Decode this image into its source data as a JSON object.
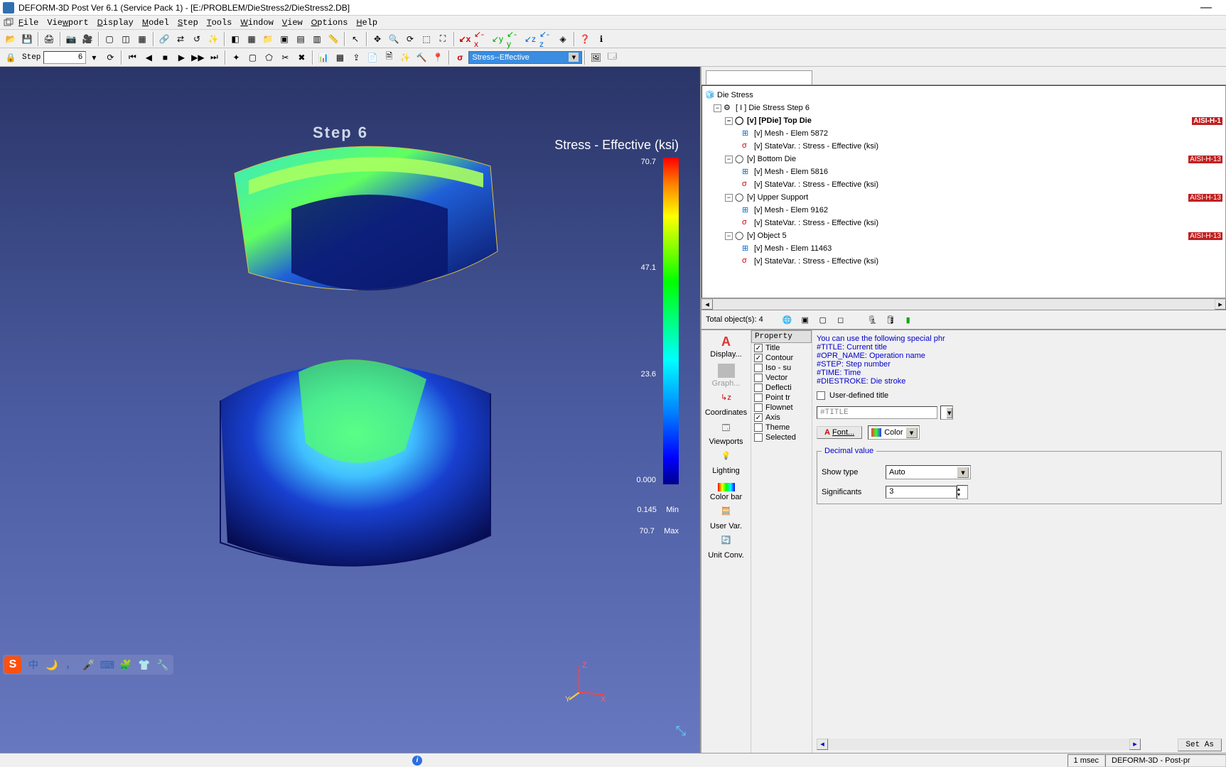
{
  "window": {
    "title": "DEFORM-3D Post Ver 6.1 (Service Pack 1)   - [E:/PROBLEM/DieStress2/DieStress2.DB]"
  },
  "menu": {
    "items": [
      "File",
      "Viewport",
      "Display",
      "Model",
      "Step",
      "Tools",
      "Window",
      "View",
      "Options",
      "Help"
    ]
  },
  "toolbar2": {
    "step_label": "Step",
    "step_value": "6",
    "variable": "Stress--Effective"
  },
  "viewport": {
    "step_title": "Step    6",
    "variable_title": "Stress - Effective (ksi)",
    "colorbar": {
      "max": "70.7",
      "t2": "47.1",
      "t3": "23.6",
      "min": "0.000"
    },
    "min_value": "0.145",
    "min_label": "Min",
    "max_value": "70.7",
    "max_label": "Max",
    "axes": {
      "x": "X",
      "y": "Y",
      "z": "Z"
    }
  },
  "tree": {
    "root": "Die Stress",
    "operation": "[ I ]  Die Stress  Step 6",
    "objects": [
      {
        "name": "[v] [PDie] Top Die",
        "material": "AISI-H-1",
        "mesh": "[v] Mesh - Elem 5872",
        "sv": "[v] StateVar. :  Stress - Effective (ksi)",
        "selected": true
      },
      {
        "name": "[v] Bottom Die",
        "material": "AISI-H-13",
        "mesh": "[v] Mesh - Elem 5816",
        "sv": "[v] StateVar. :  Stress - Effective (ksi)"
      },
      {
        "name": "[v] Upper Support",
        "material": "AISI-H-13",
        "mesh": "[v] Mesh - Elem 9162",
        "sv": "[v] StateVar. :  Stress - Effective (ksi)"
      },
      {
        "name": "[v] Object 5",
        "material": "AISI-H-13",
        "mesh": "[v] Mesh - Elem 11463",
        "sv": "[v] StateVar. :  Stress - Effective (ksi)"
      }
    ]
  },
  "objbar": {
    "total": "Total object(s): 4"
  },
  "prop_left": {
    "items": [
      "Display...",
      "Graph...",
      "Coordinates",
      "Viewports",
      "Lighting",
      "Color bar",
      "User Var.",
      "Unit Conv."
    ]
  },
  "prop_mid": {
    "header": "Property",
    "rows": [
      {
        "label": "Title",
        "on": true
      },
      {
        "label": "Contour",
        "on": true
      },
      {
        "label": "Iso - su",
        "on": false
      },
      {
        "label": "Vector",
        "on": false
      },
      {
        "label": "Deflecti",
        "on": false
      },
      {
        "label": "Point tr",
        "on": false
      },
      {
        "label": "Flownet",
        "on": false
      },
      {
        "label": "Axis",
        "on": true
      },
      {
        "label": "Theme",
        "on": false
      },
      {
        "label": "Selected",
        "on": false
      }
    ]
  },
  "prop_right": {
    "hint0": "You can use the following special phr",
    "hint1": "#TITLE: Current title",
    "hint2": "#OPR_NAME: Operation name",
    "hint3": "#STEP: Step number",
    "hint4": "#TIME: Time",
    "hint5": "#DIESTROKE: Die stroke",
    "user_title_label": "User-defined title",
    "title_placeholder": "#TITLE",
    "font_btn": "Font...",
    "color_label": "Color",
    "decimal_legend": "Decimal value",
    "show_type_label": "Show type",
    "show_type_value": "Auto",
    "sig_label": "Significants",
    "sig_value": "3",
    "setas_btn": "Set As"
  },
  "statusbar": {
    "time": "1 msec",
    "mode": "DEFORM-3D  -  Post-pr"
  }
}
